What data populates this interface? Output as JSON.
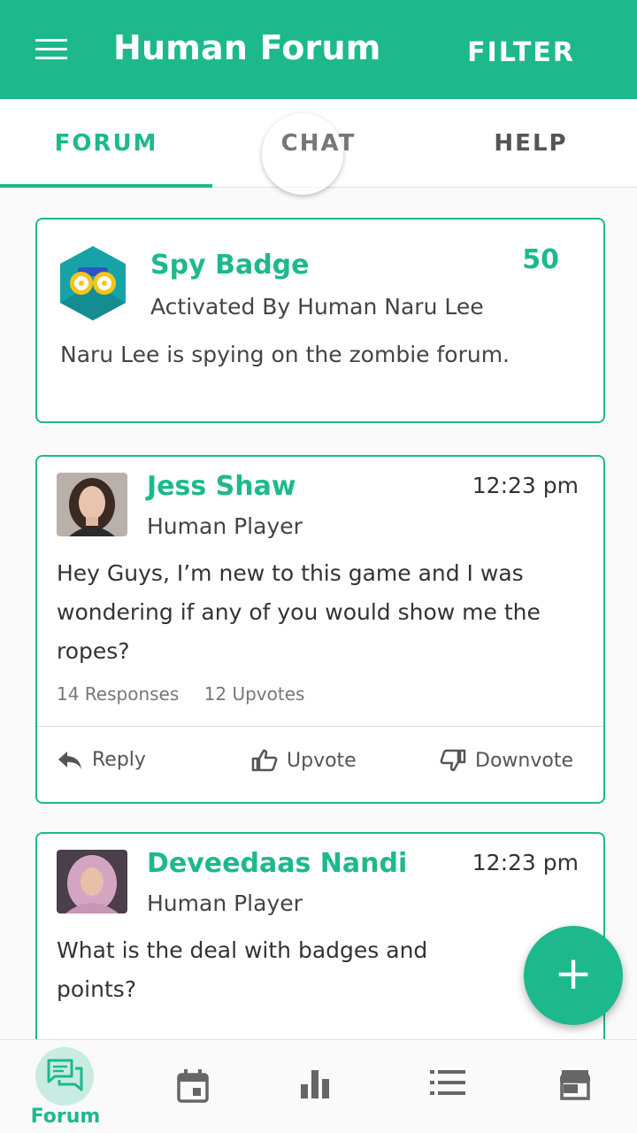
{
  "appbar": {
    "title": "Human Forum",
    "filter_label": "FILTER"
  },
  "tabs": [
    {
      "label": "FORUM"
    },
    {
      "label": "CHAT"
    },
    {
      "label": "HELP"
    }
  ],
  "badge_card": {
    "title": "Spy Badge",
    "points": "50",
    "subtitle": "Activated By Human Naru Lee",
    "description": "Naru Lee is spying on the zombie forum."
  },
  "posts": [
    {
      "name": "Jess Shaw",
      "time": "12:23 pm",
      "role": "Human Player",
      "body": "Hey Guys, I’m new to this game and I was wondering if any of you would show me the ropes?",
      "responses": "14 Responses",
      "upvotes": "12 Upvotes",
      "actions": {
        "reply": "Reply",
        "upvote": "Upvote",
        "downvote": "Downvote"
      }
    },
    {
      "name": "Deveedaas Nandi",
      "time": "12:23 pm",
      "role": "Human Player",
      "body": "What is the deal with badges and points?"
    }
  ],
  "fab": {
    "label": "+"
  },
  "bottom_nav": [
    {
      "label": "Forum",
      "icon": "forum-icon"
    },
    {
      "icon": "calendar-icon"
    },
    {
      "icon": "bar-chart-icon"
    },
    {
      "icon": "list-icon"
    },
    {
      "icon": "store-icon"
    }
  ],
  "colors": {
    "primary": "#1db98c",
    "primary_light": "#c8ece1"
  }
}
